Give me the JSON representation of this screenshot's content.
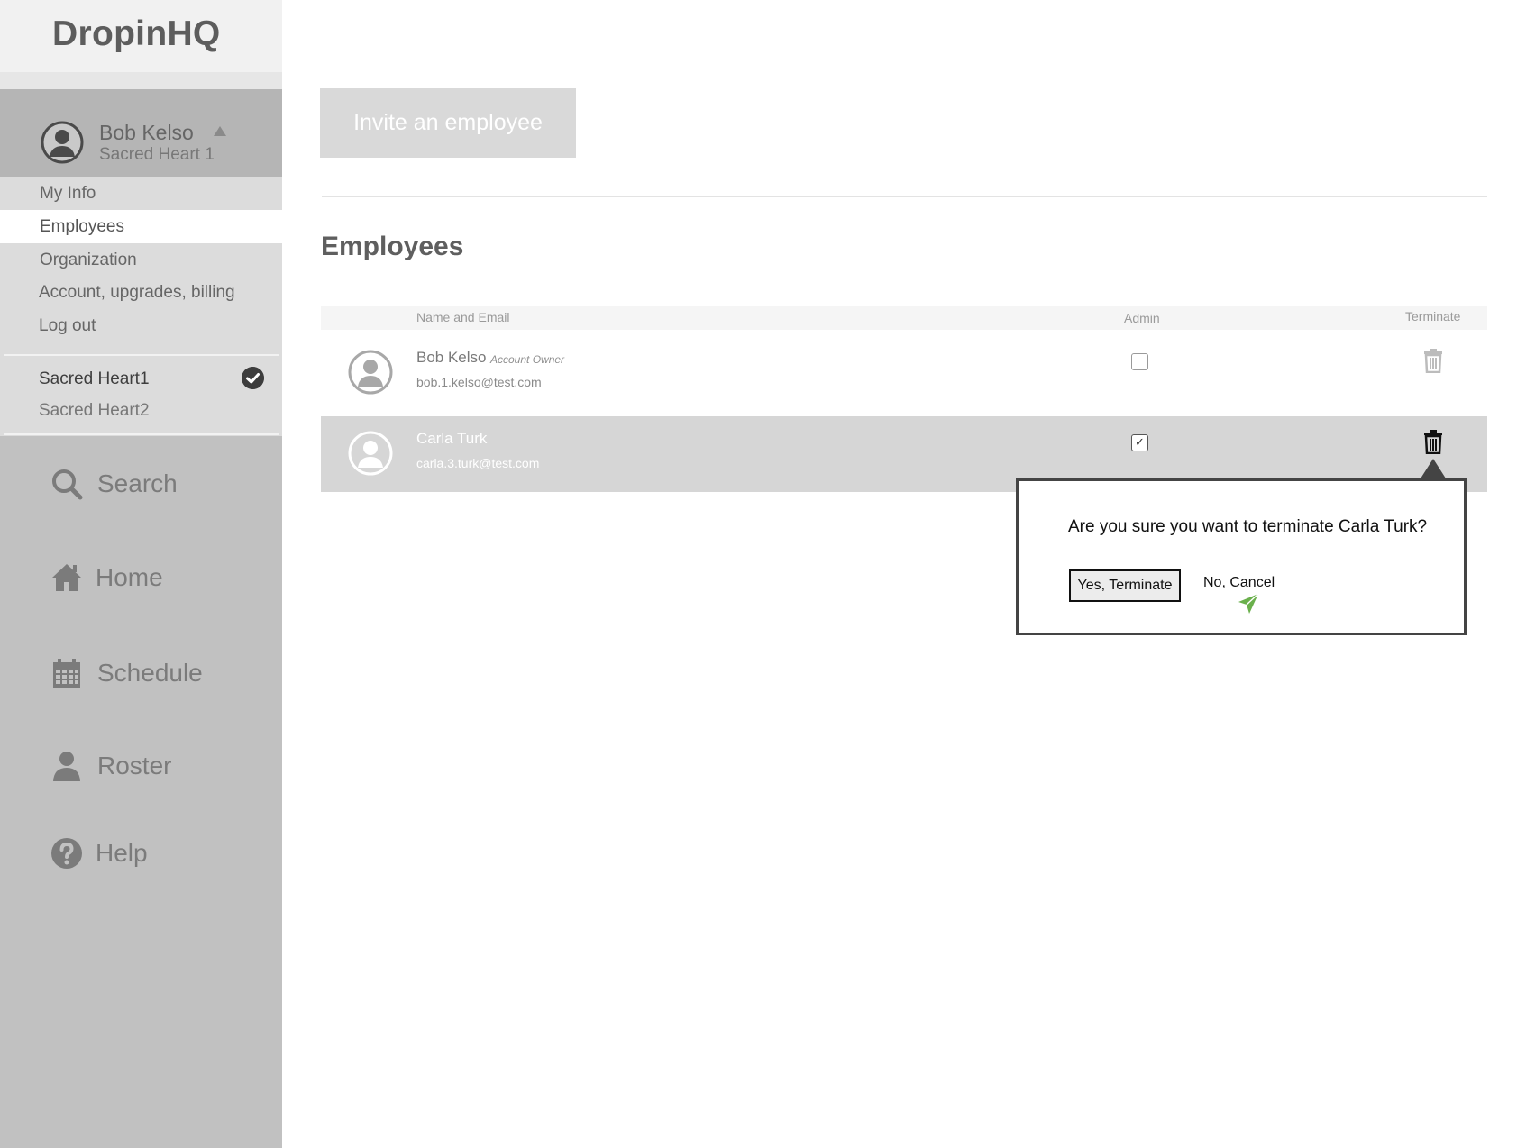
{
  "app": {
    "title": "DropinHQ"
  },
  "user": {
    "name": "Bob Kelso",
    "org": "Sacred Heart 1"
  },
  "menu": {
    "items": [
      {
        "label": "My Info"
      },
      {
        "label": "Employees"
      },
      {
        "label": "Organization"
      },
      {
        "label": "Account, upgrades, billing"
      },
      {
        "label": "Log out"
      }
    ],
    "active": "Employees"
  },
  "organizations": [
    {
      "label": "Sacred Heart1",
      "current": true
    },
    {
      "label": "Sacred Heart2",
      "current": false
    }
  ],
  "nav": [
    {
      "label": "Search",
      "icon": "search-icon"
    },
    {
      "label": "Home",
      "icon": "home-icon"
    },
    {
      "label": "Schedule",
      "icon": "calendar-icon"
    },
    {
      "label": "Roster",
      "icon": "person-icon"
    },
    {
      "label": "Help",
      "icon": "help-icon"
    }
  ],
  "main": {
    "invite_label": "Invite an employee",
    "section_title": "Employees",
    "table": {
      "columns": [
        "Name and Email",
        "Admin",
        "Terminate"
      ],
      "rows": [
        {
          "name": "Bob Kelso",
          "role": "Account Owner",
          "email": "bob.1.kelso@test.com",
          "admin": false,
          "selected": false
        },
        {
          "name": "Carla Turk",
          "role": "",
          "email": "carla.3.turk@test.com",
          "admin": true,
          "selected": true
        }
      ]
    }
  },
  "confirm": {
    "message": "Are you sure you want to terminate Carla Turk?",
    "yes_label": "Yes, Terminate",
    "no_label": "No, Cancel"
  },
  "colors": {
    "sidebar": "#c1c1c1",
    "selected_row": "#d6d6d6",
    "cursor": "#6ab04c"
  }
}
